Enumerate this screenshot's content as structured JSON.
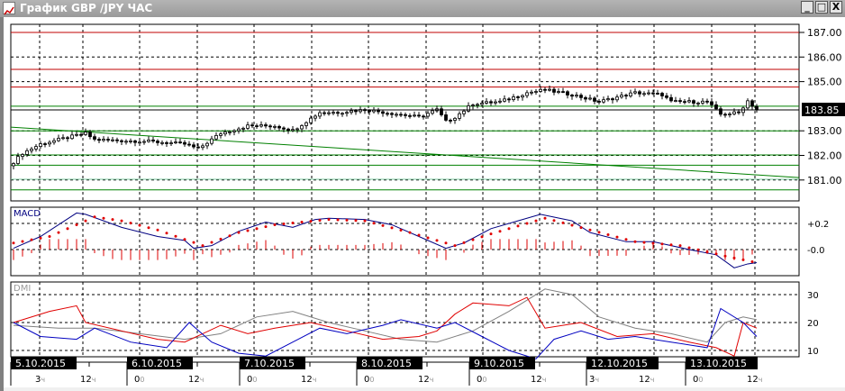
{
  "window": {
    "title": "График GBP /JPY  ЧАС",
    "minimize_label": "_",
    "maximize_label": "□",
    "close_label": "X"
  },
  "colors": {
    "up": "#ffffff",
    "down": "#000000",
    "resistance": "#c00000",
    "support": "#008000",
    "trend": "#008000",
    "teal": "#7fc8a0",
    "macd": "#000080",
    "signal": "#e00000",
    "plus_di": "#e00000",
    "minus_di": "#0000c0",
    "adx": "#808080"
  },
  "chart_data": [
    {
      "type": "candlestick",
      "title": "GBP/JPY H1",
      "y_ticks": [
        "187.00",
        "186.00",
        "185.00",
        "183.00",
        "182.00",
        "181.00"
      ],
      "ylim": [
        180.4,
        187.35
      ],
      "current_price": 183.85,
      "current_price_label": "183.85",
      "close_anchors": [
        [
          0,
          181.73
        ],
        [
          2,
          182.09
        ],
        [
          6,
          182.46
        ],
        [
          10,
          182.64
        ],
        [
          16,
          182.9
        ],
        [
          18,
          182.64
        ],
        [
          24,
          182.6
        ],
        [
          30,
          182.57
        ],
        [
          38,
          182.46
        ],
        [
          41,
          182.27
        ],
        [
          46,
          182.9
        ],
        [
          52,
          183.2
        ],
        [
          58,
          183.2
        ],
        [
          62,
          183.02
        ],
        [
          65,
          183.38
        ],
        [
          68,
          183.75
        ],
        [
          72,
          183.75
        ],
        [
          78,
          183.86
        ],
        [
          84,
          183.71
        ],
        [
          90,
          183.56
        ],
        [
          94,
          183.86
        ],
        [
          96,
          183.38
        ],
        [
          98,
          183.56
        ],
        [
          102,
          184.1
        ],
        [
          108,
          184.18
        ],
        [
          114,
          184.55
        ],
        [
          118,
          184.66
        ],
        [
          124,
          184.47
        ],
        [
          130,
          184.18
        ],
        [
          138,
          184.55
        ],
        [
          144,
          184.47
        ],
        [
          146,
          184.18
        ],
        [
          154,
          184.18
        ],
        [
          157,
          183.67
        ],
        [
          161,
          183.74
        ],
        [
          163,
          184.22
        ],
        [
          165,
          183.85
        ]
      ],
      "levels": [
        {
          "price": 187.0,
          "kind": "resistance"
        },
        {
          "price": 185.5,
          "kind": "resistance"
        },
        {
          "price": 184.78,
          "kind": "resistance"
        },
        {
          "price": 184.0,
          "kind": "support"
        },
        {
          "price": 183.0,
          "kind": "support"
        },
        {
          "price": 182.02,
          "kind": "support"
        },
        {
          "price": 181.6,
          "kind": "support"
        },
        {
          "price": 181.03,
          "kind": "teal"
        },
        {
          "price": 180.6,
          "kind": "support"
        }
      ],
      "trendline": [
        [
          0,
          183.15
        ],
        [
          175,
          181.1
        ]
      ]
    },
    {
      "type": "line",
      "title": "MACD",
      "y_ticks": [
        "+0.2",
        "-0.0"
      ],
      "ylim": [
        -0.2,
        0.32
      ],
      "macd": [
        [
          0,
          0.01
        ],
        [
          6,
          0.1
        ],
        [
          14,
          0.28
        ],
        [
          16,
          0.27
        ],
        [
          20,
          0.22
        ],
        [
          24,
          0.17
        ],
        [
          32,
          0.1
        ],
        [
          38,
          0.07
        ],
        [
          40,
          0.01
        ],
        [
          44,
          0.03
        ],
        [
          50,
          0.14
        ],
        [
          56,
          0.21
        ],
        [
          62,
          0.17
        ],
        [
          67,
          0.23
        ],
        [
          70,
          0.24
        ],
        [
          78,
          0.23
        ],
        [
          84,
          0.19
        ],
        [
          90,
          0.1
        ],
        [
          96,
          0.01
        ],
        [
          100,
          0.05
        ],
        [
          106,
          0.16
        ],
        [
          112,
          0.22
        ],
        [
          117,
          0.27
        ],
        [
          124,
          0.22
        ],
        [
          128,
          0.13
        ],
        [
          136,
          0.06
        ],
        [
          142,
          0.06
        ],
        [
          150,
          0.0
        ],
        [
          156,
          -0.04
        ],
        [
          160,
          -0.14
        ],
        [
          163,
          -0.11
        ],
        [
          165,
          -0.1
        ]
      ],
      "signal": [
        [
          0,
          0.05
        ],
        [
          8,
          0.1
        ],
        [
          18,
          0.25
        ],
        [
          24,
          0.22
        ],
        [
          32,
          0.15
        ],
        [
          42,
          0.03
        ],
        [
          50,
          0.13
        ],
        [
          58,
          0.19
        ],
        [
          70,
          0.23
        ],
        [
          78,
          0.22
        ],
        [
          88,
          0.13
        ],
        [
          98,
          0.03
        ],
        [
          106,
          0.12
        ],
        [
          118,
          0.24
        ],
        [
          128,
          0.15
        ],
        [
          138,
          0.06
        ],
        [
          148,
          0.03
        ],
        [
          158,
          -0.05
        ],
        [
          165,
          -0.1
        ]
      ]
    },
    {
      "type": "line",
      "title": "DMI",
      "y_ticks": [
        "30",
        "20",
        "10"
      ],
      "ylim": [
        5.5,
        34.5
      ],
      "plus_di": [
        [
          0,
          20
        ],
        [
          8,
          24
        ],
        [
          14,
          26
        ],
        [
          16,
          20
        ],
        [
          24,
          17
        ],
        [
          32,
          14
        ],
        [
          38,
          13
        ],
        [
          46,
          19
        ],
        [
          52,
          16
        ],
        [
          58,
          18
        ],
        [
          66,
          20
        ],
        [
          74,
          17
        ],
        [
          82,
          14
        ],
        [
          90,
          15
        ],
        [
          94,
          17
        ],
        [
          98,
          23
        ],
        [
          102,
          27
        ],
        [
          110,
          26
        ],
        [
          114,
          29
        ],
        [
          118,
          18
        ],
        [
          126,
          20
        ],
        [
          134,
          15
        ],
        [
          142,
          16
        ],
        [
          150,
          13
        ],
        [
          156,
          11
        ],
        [
          160,
          8
        ],
        [
          162,
          20
        ],
        [
          165,
          18
        ]
      ],
      "minus_di": [
        [
          0,
          20
        ],
        [
          6,
          15
        ],
        [
          14,
          14
        ],
        [
          18,
          18
        ],
        [
          26,
          13
        ],
        [
          34,
          11
        ],
        [
          39,
          20
        ],
        [
          44,
          13
        ],
        [
          50,
          9
        ],
        [
          56,
          8
        ],
        [
          62,
          13
        ],
        [
          68,
          18
        ],
        [
          74,
          16
        ],
        [
          82,
          19
        ],
        [
          86,
          21
        ],
        [
          94,
          18
        ],
        [
          98,
          20
        ],
        [
          104,
          15
        ],
        [
          110,
          10
        ],
        [
          116,
          7
        ],
        [
          120,
          14
        ],
        [
          126,
          17
        ],
        [
          132,
          14
        ],
        [
          138,
          15
        ],
        [
          146,
          13
        ],
        [
          154,
          11
        ],
        [
          157,
          25
        ],
        [
          162,
          20
        ],
        [
          165,
          15
        ]
      ],
      "adx": [
        [
          0,
          19
        ],
        [
          10,
          18
        ],
        [
          18,
          18
        ],
        [
          28,
          16
        ],
        [
          38,
          14
        ],
        [
          46,
          16
        ],
        [
          54,
          22
        ],
        [
          62,
          24
        ],
        [
          70,
          20
        ],
        [
          78,
          17
        ],
        [
          86,
          14
        ],
        [
          94,
          13
        ],
        [
          102,
          17
        ],
        [
          110,
          24
        ],
        [
          118,
          32
        ],
        [
          124,
          30
        ],
        [
          130,
          22
        ],
        [
          138,
          18
        ],
        [
          146,
          16
        ],
        [
          154,
          13
        ],
        [
          158,
          20
        ],
        [
          162,
          22
        ],
        [
          165,
          21
        ]
      ]
    }
  ],
  "time_axis": {
    "dates": [
      {
        "label": "5.10.2015",
        "hour": 0
      },
      {
        "label": "6.10.2015",
        "hour": 26
      },
      {
        "label": "7.10.2015",
        "hour": 51
      },
      {
        "label": "8.10.2015",
        "hour": 77
      },
      {
        "label": "9.10.2015",
        "hour": 102
      },
      {
        "label": "12.10.2015",
        "hour": 128
      },
      {
        "label": "13.10.2015",
        "hour": 150
      }
    ],
    "hours": [
      {
        "num": "3",
        "unit": "ч",
        "hour": 6
      },
      {
        "num": "12",
        "unit": "ч",
        "hour": 16
      },
      {
        "num": "0",
        "unit": "0",
        "hour": 28
      },
      {
        "num": "12",
        "unit": "ч",
        "hour": 40
      },
      {
        "num": "0",
        "unit": "0",
        "hour": 53
      },
      {
        "num": "12",
        "unit": "ч",
        "hour": 65
      },
      {
        "num": "0",
        "unit": "0",
        "hour": 79
      },
      {
        "num": "12",
        "unit": "ч",
        "hour": 91
      },
      {
        "num": "0",
        "unit": "0",
        "hour": 104
      },
      {
        "num": "12",
        "unit": "ч",
        "hour": 116
      },
      {
        "num": "3",
        "unit": "ч",
        "hour": 129
      },
      {
        "num": "12",
        "unit": "ч",
        "hour": 140
      },
      {
        "num": "0",
        "unit": "0",
        "hour": 152
      },
      {
        "num": "12",
        "unit": "ч",
        "hour": 164
      }
    ]
  }
}
